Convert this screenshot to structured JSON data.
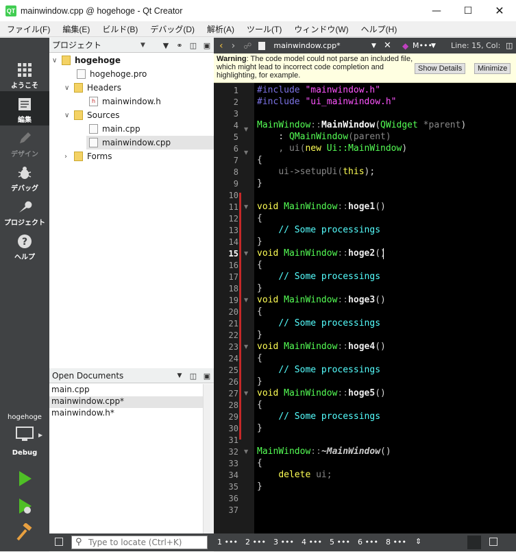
{
  "window": {
    "title": "mainwindow.cpp @ hogehoge - Qt Creator",
    "logo": "QT"
  },
  "menu": [
    "ファイル(F)",
    "編集(E)",
    "ビルド(B)",
    "デバッグ(D)",
    "解析(A)",
    "ツール(T)",
    "ウィンドウ(W)",
    "ヘルプ(H)"
  ],
  "modes": {
    "welcome": "ようこそ",
    "edit": "編集",
    "design": "デザイン",
    "debug": "デバッグ",
    "projects": "プロジェクト",
    "help": "ヘルプ"
  },
  "kit": {
    "project": "hogehoge",
    "config": "Debug"
  },
  "project_pane": {
    "title": "プロジェクト",
    "tree": {
      "root": "hogehoge",
      "pro": "hogehoge.pro",
      "headers": "Headers",
      "header_file": "mainwindow.h",
      "sources": "Sources",
      "src1": "main.cpp",
      "src2": "mainwindow.cpp",
      "forms": "Forms"
    }
  },
  "open_docs": {
    "title": "Open Documents",
    "items": [
      "main.cpp",
      "mainwindow.cpp*",
      "mainwindow.h*"
    ]
  },
  "editor": {
    "file": "mainwindow.cpp*",
    "symbol": "M•••",
    "position": "Line: 15, Col:",
    "warning_label": "Warning",
    "warning_text": ": The code model could not parse an included file, which might lead to incorrect code completion and highlighting, for example.",
    "show_details": "Show Details",
    "minimize": "Minimize"
  },
  "code": {
    "include": "#include",
    "h1": "\"mainwindow.h\"",
    "h2": "\"ui_mainwindow.h\"",
    "cls": "MainWindow",
    "sep": "::",
    "qwidget": "QWidget",
    "parent": "*parent",
    "qmain": "QMainWindow",
    "parent_arg": "(parent)",
    "ui_init": ", ui(",
    "new_kw": "new",
    "ui_type": "Ui::MainWindow",
    "setup": "ui->setupUi(",
    "this_kw": "this",
    "void_kw": "void",
    "comment": "// Some processings",
    "funcs": [
      "hoge1",
      "hoge2",
      "hoge3",
      "hoge4",
      "hoge5"
    ],
    "dtor": "~MainWindow",
    "delete_kw": "delete",
    "ui_var": "ui;"
  },
  "line_numbers": [
    1,
    2,
    3,
    4,
    5,
    6,
    7,
    8,
    9,
    10,
    11,
    12,
    13,
    14,
    15,
    16,
    17,
    18,
    19,
    20,
    21,
    22,
    23,
    24,
    25,
    26,
    27,
    28,
    29,
    30,
    31,
    32,
    33,
    34,
    35,
    36,
    37
  ],
  "status": {
    "locate_placeholder": "Type to locate (Ctrl+K)",
    "panes": [
      "1 •••",
      "2 •••",
      "3 •••",
      "4 •••",
      "5 •••",
      "6 •••",
      "8 •••"
    ]
  }
}
